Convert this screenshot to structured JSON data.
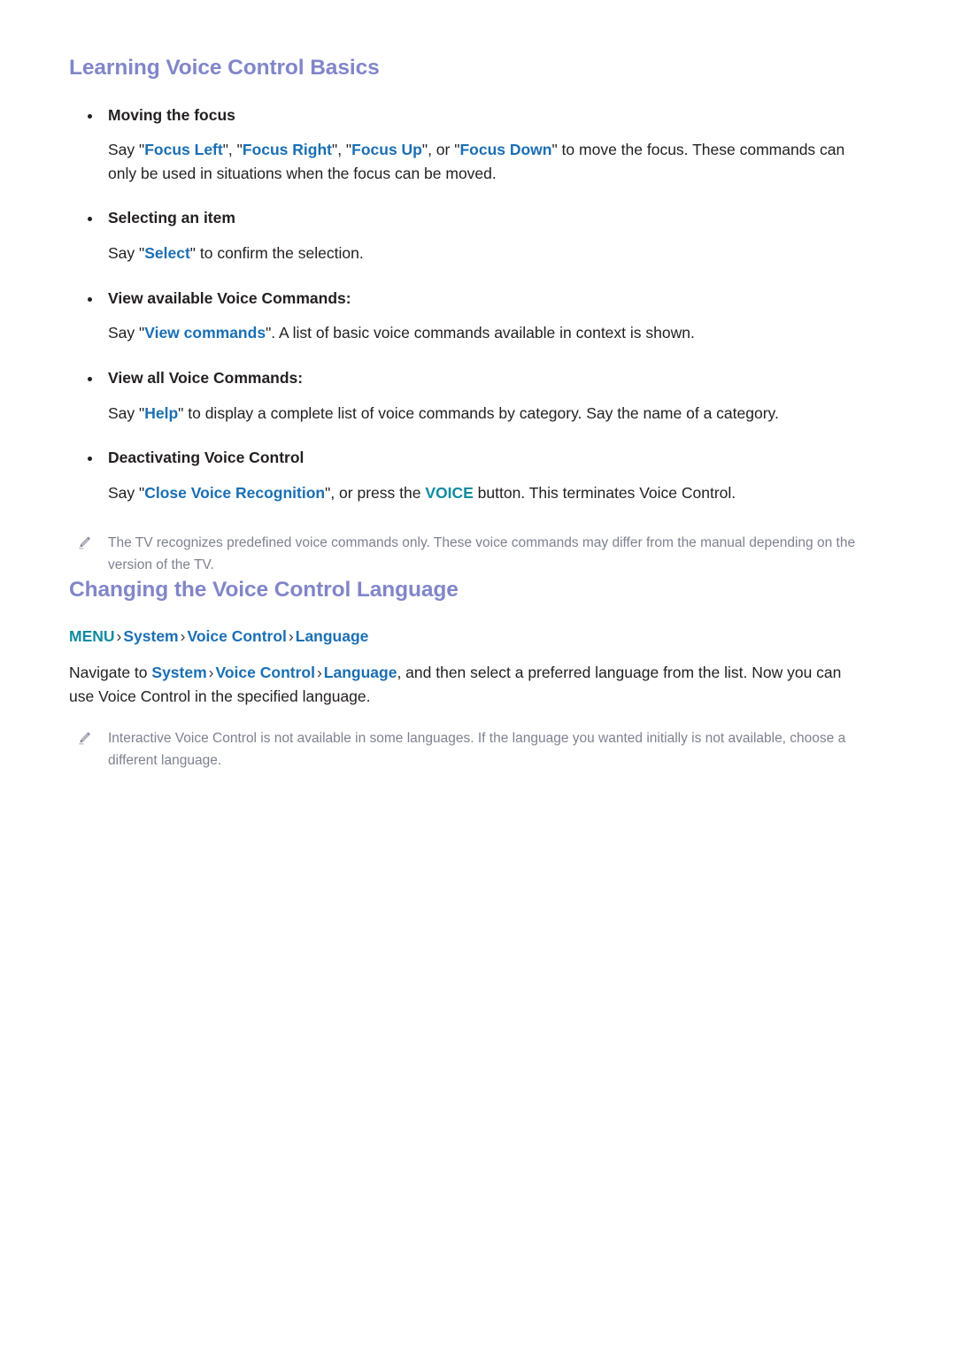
{
  "document": {
    "colors": {
      "heading": "#8186c9",
      "command": "#1a6fb4",
      "key": "#0f8ba0",
      "breadcrumb": "#1a6fb4",
      "body_text": "#231f20",
      "note_text": "#7e8290",
      "background": "#ffffff"
    }
  },
  "sections": [
    {
      "heading": "Learning Voice Control Basics",
      "items": [
        {
          "title": "Moving the focus",
          "body_parts": [
            {
              "text": "Say \"",
              "style": "plain"
            },
            {
              "text": "Focus Left",
              "style": "command"
            },
            {
              "text": "\", \"",
              "style": "plain"
            },
            {
              "text": "Focus Right",
              "style": "command"
            },
            {
              "text": "\", \"",
              "style": "plain"
            },
            {
              "text": "Focus Up",
              "style": "command"
            },
            {
              "text": "\", or \"",
              "style": "plain"
            },
            {
              "text": "Focus Down",
              "style": "command"
            },
            {
              "text": "\" to move the focus. These commands can only be used in situations when the focus can be moved.",
              "style": "plain"
            }
          ],
          "body_plain": "Say \"Focus Left\", \"Focus Right\", \"Focus Up\", or \"Focus Down\" to move the focus. These commands can only be used in situations when the focus can be moved."
        },
        {
          "title": "Selecting an item",
          "body_parts": [
            {
              "text": "Say \"",
              "style": "plain"
            },
            {
              "text": "Select",
              "style": "command"
            },
            {
              "text": "\" to confirm the selection.",
              "style": "plain"
            }
          ],
          "body_plain": "Say \"Select\" to confirm the selection."
        },
        {
          "title": "View available Voice Commands:",
          "body_parts": [
            {
              "text": "Say \"",
              "style": "plain"
            },
            {
              "text": "View commands",
              "style": "command"
            },
            {
              "text": "\". A list of basic voice commands available in context is shown.",
              "style": "plain"
            }
          ],
          "body_plain": "Say \"View commands\". A list of basic voice commands available in context is shown."
        },
        {
          "title": "View all Voice Commands:",
          "body_parts": [
            {
              "text": "Say \"",
              "style": "plain"
            },
            {
              "text": "Help",
              "style": "command"
            },
            {
              "text": "\" to display a complete list of voice commands by category. Say the name of a category.",
              "style": "plain"
            }
          ],
          "body_plain": "Say \"Help\" to display a complete list of voice commands by category. Say the name of a category."
        },
        {
          "title": "Deactivating Voice Control",
          "body_parts": [
            {
              "text": "Say \"",
              "style": "plain"
            },
            {
              "text": "Close Voice Recognition",
              "style": "command"
            },
            {
              "text": "\", or press the ",
              "style": "plain"
            },
            {
              "text": "VOICE",
              "style": "key"
            },
            {
              "text": " button. This terminates Voice Control.",
              "style": "plain"
            }
          ],
          "body_plain": "Say \"Close Voice Recognition\", or press the VOICE button. This terminates Voice Control."
        }
      ],
      "note": "The TV recognizes predefined voice commands only. These voice commands may differ from the manual depending on the version of the TV."
    },
    {
      "heading": "Changing the Voice Control Language",
      "breadcrumb": {
        "menu_label": "MENU",
        "separator": "›",
        "crumbs": [
          "System",
          "Voice Control",
          "Language"
        ]
      },
      "navigate_paragraph": {
        "lead": "Navigate to ",
        "crumbs": [
          "System",
          "Voice Control",
          "Language"
        ],
        "separator": "›",
        "tail": ", and then select a preferred language from the list. Now you can use Voice Control in the specified language.",
        "plain": "Navigate to System › Voice Control › Language, and then select a preferred language from the list. Now you can use Voice Control in the specified language."
      },
      "note": "Interactive Voice Control is not available in some languages. If the language you wanted initially is not available, choose a different language."
    }
  ],
  "icons": {
    "note": "pencil-icon"
  }
}
